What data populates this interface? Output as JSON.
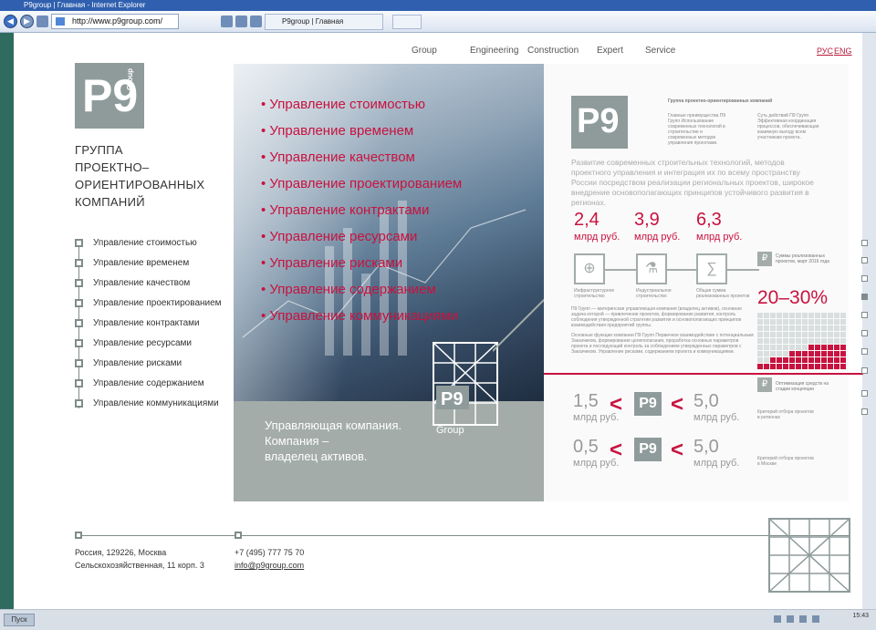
{
  "browser": {
    "window_title": "P9group | Главная - Internet Explorer",
    "url": "http://www.p9group.com/",
    "tab_label": "P9group | Главная"
  },
  "nav": {
    "items": [
      "Group",
      "Engineering",
      "Construction",
      "Expert",
      "Service"
    ],
    "lang_ru": "РУС",
    "lang_en": "ENG"
  },
  "logo": {
    "text": "P9",
    "side": "Group"
  },
  "tagline": [
    "ГРУППА",
    "ПРОЕКТНО–",
    "ОРИЕНТИРОВАННЫХ",
    "КОМПАНИЙ"
  ],
  "services": [
    "Управление стоимостью",
    "Управление временем",
    "Управление качеством",
    "Управление проектированием",
    "Управление контрактами",
    "Управление ресурсами",
    "Управление рисками",
    "Управление содержанием",
    "Управление коммуникациями"
  ],
  "hero": {
    "caption_1": "Управляющая компания.",
    "caption_2": "Компания –",
    "caption_3": "владелец активов.",
    "group_word": "Group"
  },
  "panel": {
    "heading": "Группа проектно-ориентированных компаний",
    "col1": "Главные преимущества П9 Групп Использование современных технологий в строительстве и современных методов управления проектами.",
    "col2": "Суть действий П9 Групп Эффективная координация процессов, обеспечивающая взаимную выгоду всем участникам проекта.",
    "development": "Развитие современных строительных технологий, методов проектного управления и интеграция их по всему пространству России посредством реализации региональных проектов, широкое внедрение основополагающих принципов устойчивого развития в регионах.",
    "stats": [
      {
        "value": "2,4",
        "unit": "млрд руб."
      },
      {
        "value": "3,9",
        "unit": "млрд руб."
      },
      {
        "value": "6,3",
        "unit": "млрд руб."
      }
    ],
    "icon_labels": [
      "Инфраструктурное строительство",
      "Индустриальное строительство",
      "Общая сумма реализованных проектов"
    ],
    "sum_note": "Суммы реализованных проектов, март 2016 года",
    "percent": "20–30%",
    "body1": "П9 Групп — материнская управляющая компания (владелец активов), основная задача которой — привлечение проектов, формирование развития, контроль соблюдения утвержденной стратегии развития и основополагающих принципов взаимодействия предприятий группы.",
    "body2": "Основные функции компании П9 Групп Первичное взаимодействие с потенциальным Заказчиком, формирование целеполагания, проработка основных параметров проекта и последующий контроль за соблюдением утвержденных параметров с Заказчиком. Управление рисками, содержанием проекта и коммуникациями.",
    "optim_note": "Оптимизация средств на стадии концепции",
    "compare": [
      {
        "left": "1,5",
        "left_unit": "млрд руб.",
        "right": "5,0",
        "right_unit": "млрд руб.",
        "note": "Критерий отбора проектов в регионах"
      },
      {
        "left": "0,5",
        "left_unit": "млрд руб.",
        "right": "5,0",
        "right_unit": "млрд руб.",
        "note": "Критерий отбора проектов в Москве"
      }
    ]
  },
  "footer": {
    "address_1": "Россия, 129226, Москва",
    "address_2": "Сельскохозяйственная, 11 корп. 3",
    "phone": "+7 (495) 777 75 70",
    "email": "info@p9group.com"
  },
  "taskbar": {
    "start": "Пуск",
    "time": "15:43"
  },
  "colors": {
    "accent": "#c8123f",
    "gray": "#8f9b9b",
    "slate": "#a3aca8"
  }
}
